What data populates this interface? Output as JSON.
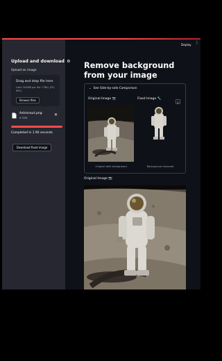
{
  "header": {
    "deploy_label": "Deploy",
    "menu_icon": "kebab-menu-icon"
  },
  "sidebar": {
    "title": "Upload and download",
    "title_icon": "⚙",
    "upload_label": "Upload an image",
    "dropzone": {
      "title": "Drag and drop file here",
      "subtitle": "Limit 200MB per file • PNG, JPG, JPEG",
      "browse_label": "Browse files"
    },
    "file": {
      "name": "Astronaut.png",
      "size": "6.3MB",
      "close_icon": "close-icon"
    },
    "progress_percent": 100,
    "status": "Completed in 1.90 seconds",
    "download_label": "Download fixed image"
  },
  "main": {
    "title": "Remove background from your image",
    "expander_label": "See Side-by-side Comparison",
    "original_label": "Original Image 📷",
    "fixed_label": "Fixed Image 🔧",
    "caption_original": "Original with background",
    "caption_fixed": "Background removed",
    "original_section_label": "Original Image 📷"
  },
  "colors": {
    "accent": "#ff4b4b",
    "sidebar_bg": "#262730",
    "main_bg": "#0e1117",
    "text": "#fafafa"
  }
}
